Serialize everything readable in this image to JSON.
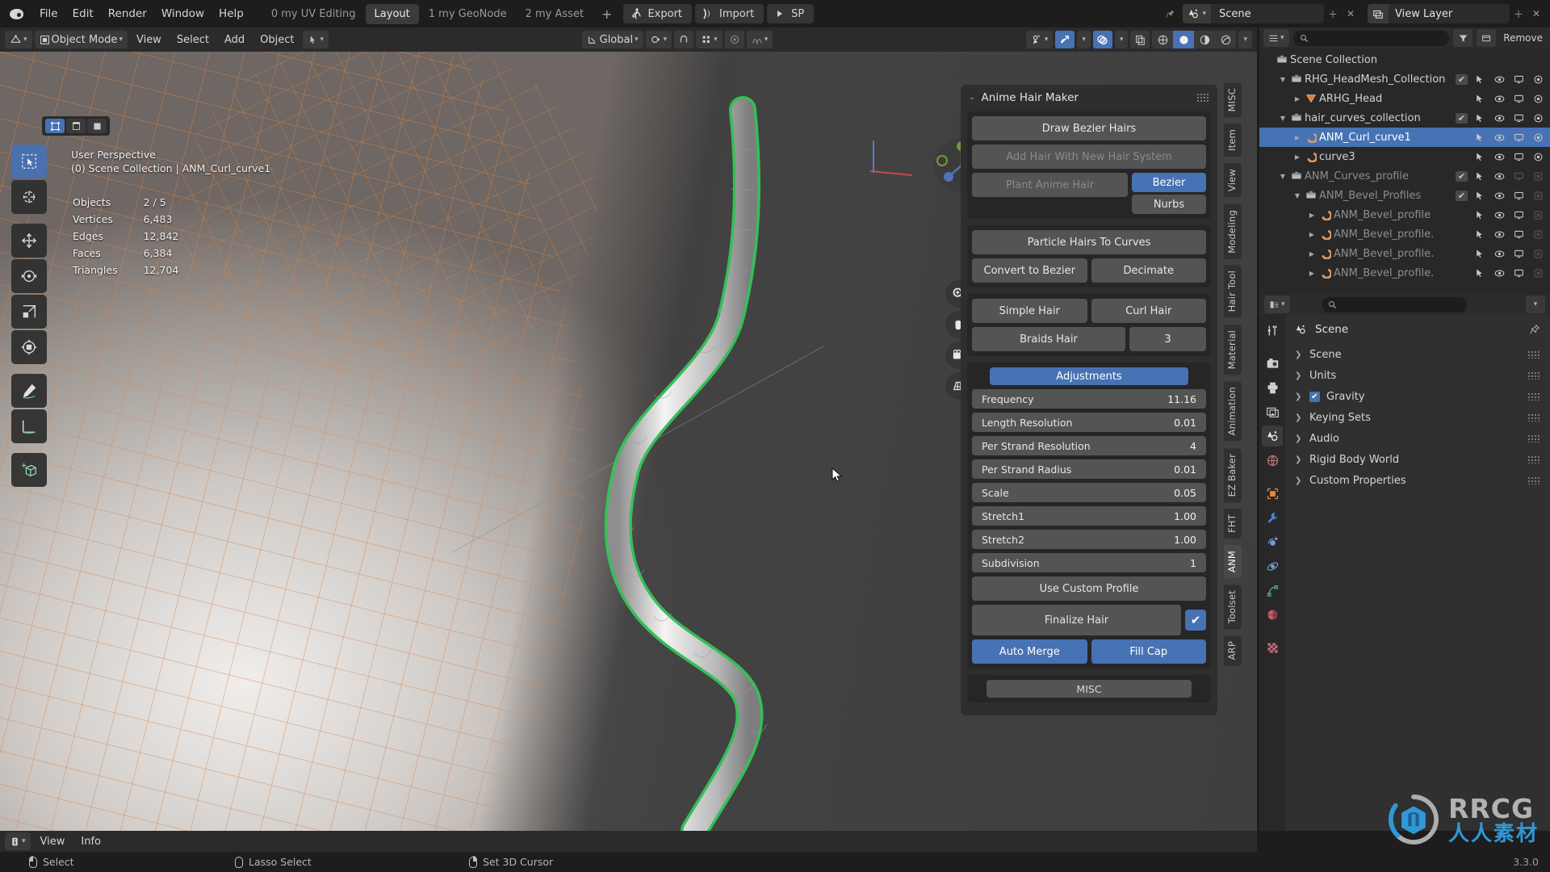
{
  "topbar": {
    "menus": [
      "File",
      "Edit",
      "Render",
      "Window",
      "Help"
    ],
    "workspaces": [
      {
        "label": "0 my UV Editing",
        "active": false
      },
      {
        "label": "Layout",
        "active": true
      },
      {
        "label": "1 my GeoNode",
        "active": false
      },
      {
        "label": "2 my Asset",
        "active": false
      }
    ],
    "add_workspace": "+",
    "buttons": [
      {
        "label": "Export",
        "icon": "export-person-icon"
      },
      {
        "label": "Import",
        "icon": "import-arrow-icon"
      },
      {
        "label": "SP",
        "icon": "play-icon"
      }
    ],
    "scene_name": "Scene",
    "scene_icon": "scene-icon",
    "view_layer_name": "View Layer",
    "view_layer_icon": "view-layer-icon"
  },
  "viewport_header": {
    "editor_type_icon": "editor-type-3dview-icon",
    "mode": "Object Mode",
    "menus": [
      "View",
      "Select",
      "Add",
      "Object"
    ],
    "transform_orientation": "Global",
    "pivot_icon": "pivot-point-icon",
    "snap_icon": "magnet-icon",
    "proportional_icon": "proportional-editing-icon",
    "falloff_icon": "falloff-curve-icon",
    "gizmo_icon": "gizmo-icon",
    "overlay_icon": "overlays-icon",
    "xray_icon": "xray-icon",
    "shading": [
      "wireframe",
      "solid",
      "material-preview",
      "rendered"
    ],
    "shading_active": "solid"
  },
  "viewport": {
    "perspective": "User Perspective",
    "collection_line": "(0) Scene Collection | ANM_Curl_curve1",
    "stats": [
      {
        "label": "Objects",
        "value": "2 / 5"
      },
      {
        "label": "Vertices",
        "value": "6,483"
      },
      {
        "label": "Edges",
        "value": "12,842"
      },
      {
        "label": "Faces",
        "value": "6,384"
      },
      {
        "label": "Triangles",
        "value": "12,704"
      }
    ],
    "tools": [
      {
        "name": "tweak-select-tool",
        "active": true
      },
      {
        "name": "cursor-tool",
        "active": false
      },
      {
        "name": "move-tool",
        "active": false
      },
      {
        "name": "rotate-tool",
        "active": false
      },
      {
        "name": "scale-tool",
        "active": false
      },
      {
        "name": "transform-tool",
        "active": false
      },
      {
        "name": "annotate-tool",
        "active": false
      },
      {
        "name": "measure-tool",
        "active": false
      },
      {
        "name": "add-cube-tool",
        "active": false
      }
    ],
    "nav_buttons": [
      "zoom-icon",
      "pan-hand-icon",
      "camera-icon",
      "perspective-ortho-icon"
    ]
  },
  "panel": {
    "title": "Anime Hair Maker",
    "draw_bezier": "Draw Bezier Hairs",
    "add_hair_new_system": "Add Hair With New Hair System",
    "plant_anime_hair": "Plant Anime Hair",
    "curve_types": [
      {
        "label": "Bezier",
        "active": true
      },
      {
        "label": "Nurbs",
        "active": false
      }
    ],
    "particle_to_curves": "Particle Hairs To Curves",
    "convert_to_bezier": "Convert to Bezier",
    "decimate": "Decimate",
    "simple_hair": "Simple Hair",
    "curl_hair": "Curl Hair",
    "braids_hair": "Braids Hair",
    "braids_value": "3",
    "adjustments_label": "Adjustments",
    "adjustments": [
      {
        "label": "Frequency",
        "value": "11.16"
      },
      {
        "label": "Length Resolution",
        "value": "0.01"
      },
      {
        "label": "Per Strand Resolution",
        "value": "4"
      },
      {
        "label": "Per Strand Radius",
        "value": "0.01"
      },
      {
        "label": "Scale",
        "value": "0.05"
      },
      {
        "label": "Stretch1",
        "value": "1.00"
      },
      {
        "label": "Stretch2",
        "value": "1.00"
      },
      {
        "label": "Subdivision",
        "value": "1"
      }
    ],
    "use_custom_profile": "Use Custom Profile",
    "finalize_hair": "Finalize Hair",
    "finalize_checked": true,
    "auto_merge": "Auto Merge",
    "fill_cap": "Fill Cap",
    "misc": "MISC"
  },
  "sidebar_tabs": [
    {
      "label": "MISC",
      "active": false
    },
    {
      "label": "Item",
      "active": false
    },
    {
      "label": "View",
      "active": false
    },
    {
      "label": "Modeling",
      "active": false
    },
    {
      "label": "Hair Tool",
      "active": false
    },
    {
      "label": "Material",
      "active": false
    },
    {
      "label": "Animation",
      "active": false
    },
    {
      "label": "EZ Baker",
      "active": false
    },
    {
      "label": "FHT",
      "active": false
    },
    {
      "label": "ANM",
      "active": true
    },
    {
      "label": "Toolset",
      "active": false
    },
    {
      "label": "ARP",
      "active": false
    }
  ],
  "outliner": {
    "header": {
      "display_mode_icon": "outliner-display-mode-icon",
      "filter_icon": "filter-icon",
      "new_collection_icon": "new-collection-icon",
      "remove_label": "Remove"
    },
    "rows": [
      {
        "name": "Scene Collection",
        "indent": 0,
        "icon": "collection-icon",
        "expand": "",
        "checkbox": false,
        "dim": false,
        "selected": false,
        "restrict": []
      },
      {
        "name": "RHG_HeadMesh_Collection",
        "indent": 1,
        "icon": "collection-icon",
        "expand": "down",
        "checkbox": true,
        "dim": false,
        "selected": false,
        "restrict": [
          "select",
          "hide",
          "viewport",
          "render"
        ]
      },
      {
        "name": "ARHG_Head",
        "indent": 2,
        "icon": "mesh-data-icon",
        "expand": "right",
        "checkbox": false,
        "dim": false,
        "selected": false,
        "restrict": [
          "select",
          "hide",
          "viewport",
          "render"
        ]
      },
      {
        "name": "hair_curves_collection",
        "indent": 1,
        "icon": "collection-icon",
        "expand": "down",
        "checkbox": true,
        "dim": false,
        "selected": false,
        "restrict": [
          "select",
          "hide",
          "viewport",
          "render"
        ]
      },
      {
        "name": "ANM_Curl_curve1",
        "indent": 2,
        "icon": "curve-icon",
        "expand": "right",
        "checkbox": false,
        "dim": false,
        "selected": true,
        "restrict": [
          "select",
          "hide",
          "viewport",
          "render"
        ]
      },
      {
        "name": "curve3",
        "indent": 2,
        "icon": "curve-icon",
        "expand": "right",
        "checkbox": false,
        "dim": false,
        "selected": false,
        "restrict": [
          "select",
          "hide",
          "viewport",
          "render"
        ]
      },
      {
        "name": "ANM_Curves_profile",
        "indent": 1,
        "icon": "collection-icon",
        "expand": "down",
        "checkbox": true,
        "dim": true,
        "selected": false,
        "restrict": [
          "select",
          "hide",
          "viewport-off",
          "render-off"
        ]
      },
      {
        "name": "ANM_Bevel_Profiles",
        "indent": 2,
        "icon": "collection-icon",
        "expand": "down",
        "checkbox": true,
        "dim": true,
        "selected": false,
        "restrict": [
          "select",
          "hide",
          "viewport",
          "render-off"
        ]
      },
      {
        "name": "ANM_Bevel_profile",
        "indent": 3,
        "icon": "curve-icon",
        "expand": "right",
        "checkbox": false,
        "dim": true,
        "selected": false,
        "restrict": [
          "select",
          "hide",
          "viewport",
          "render-off"
        ]
      },
      {
        "name": "ANM_Bevel_profile.",
        "indent": 3,
        "icon": "curve-icon",
        "expand": "right",
        "checkbox": false,
        "dim": true,
        "selected": false,
        "restrict": [
          "select",
          "hide",
          "viewport",
          "render-off"
        ]
      },
      {
        "name": "ANM_Bevel_profile.",
        "indent": 3,
        "icon": "curve-icon",
        "expand": "right",
        "checkbox": false,
        "dim": true,
        "selected": false,
        "restrict": [
          "select",
          "hide",
          "viewport",
          "render-off"
        ]
      },
      {
        "name": "ANM_Bevel_profile.",
        "indent": 3,
        "icon": "curve-icon",
        "expand": "right",
        "checkbox": false,
        "dim": true,
        "selected": false,
        "restrict": [
          "select",
          "hide",
          "viewport",
          "render-off"
        ]
      }
    ]
  },
  "properties": {
    "breadcrumb": "Scene",
    "breadcrumb_icon": "scene-properties-icon",
    "pin_icon": "pin-icon",
    "tabs": [
      {
        "name": "tool-tab",
        "icon": "tool-icon",
        "active": false
      },
      {
        "name": "render-tab",
        "icon": "camera-back-icon",
        "active": false
      },
      {
        "name": "output-tab",
        "icon": "printer-icon",
        "active": false
      },
      {
        "name": "view-layer-tab",
        "icon": "images-icon",
        "active": false
      },
      {
        "name": "scene-tab",
        "icon": "scene-cone-icon",
        "active": true
      },
      {
        "name": "world-tab",
        "icon": "world-globe-icon",
        "active": false
      },
      {
        "name": "object-tab",
        "icon": "object-square-icon",
        "active": false
      },
      {
        "name": "modifier-tab",
        "icon": "wrench-icon",
        "active": false
      },
      {
        "name": "particles-tab",
        "icon": "particles-icon",
        "active": false
      },
      {
        "name": "physics-tab",
        "icon": "physics-orbit-icon",
        "active": false
      },
      {
        "name": "data-tab",
        "icon": "curve-data-icon",
        "active": false
      },
      {
        "name": "material-tab",
        "icon": "material-sphere-icon",
        "active": false
      },
      {
        "name": "texture-tab",
        "icon": "texture-checker-icon",
        "active": false
      }
    ],
    "sections": [
      {
        "label": "Scene",
        "checkbox": false
      },
      {
        "label": "Units",
        "checkbox": false
      },
      {
        "label": "Gravity",
        "checkbox": true
      },
      {
        "label": "Keying Sets",
        "checkbox": false
      },
      {
        "label": "Audio",
        "checkbox": false
      },
      {
        "label": "Rigid Body World",
        "checkbox": false
      },
      {
        "label": "Custom Properties",
        "checkbox": false
      }
    ]
  },
  "infobar": {
    "editor_icon": "info-editor-icon",
    "menus": [
      "View",
      "Info"
    ]
  },
  "statusbar": {
    "items": [
      {
        "label": "Select",
        "mouse": "left"
      },
      {
        "label": "Lasso Select",
        "mouse": "middle"
      },
      {
        "label": "Set 3D Cursor",
        "mouse": "right"
      }
    ],
    "version": "3.3.0"
  },
  "watermark": {
    "brand": "RRCG",
    "sub": "人人素材"
  },
  "colors": {
    "accent_blue": "#4772b3",
    "panel_bg": "#2e2e2e",
    "button_gray": "#545454",
    "selection_orange": "#ed9e5c",
    "curve_green": "#30d158"
  }
}
